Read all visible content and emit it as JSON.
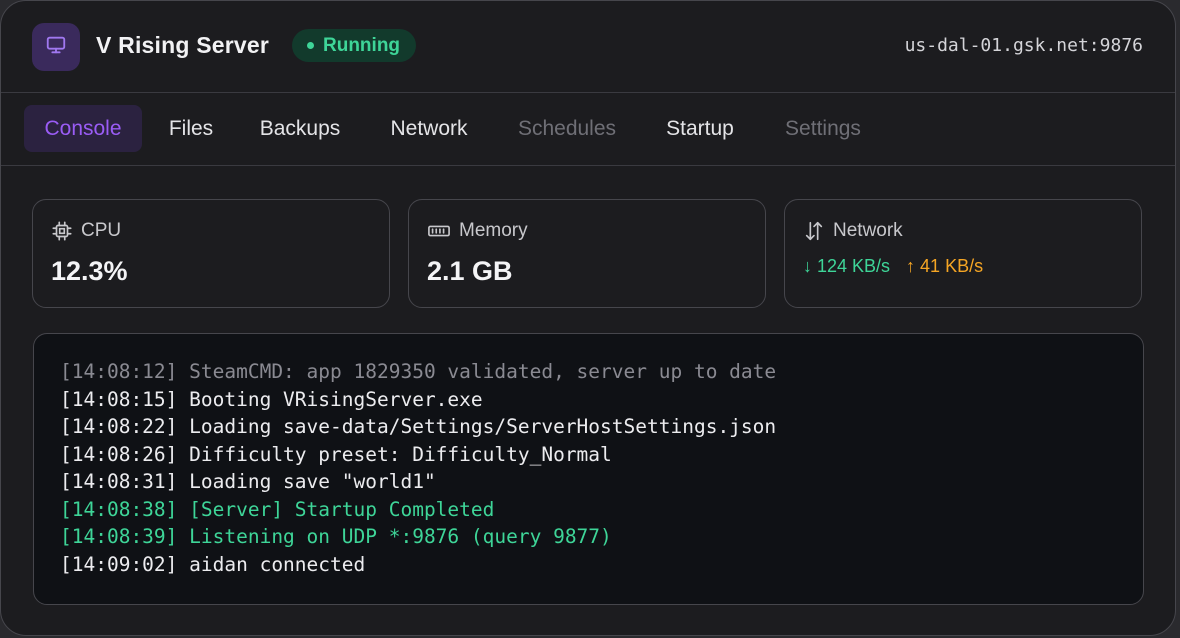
{
  "header": {
    "title": "V Rising Server",
    "status": "Running",
    "address": "us-dal-01.gsk.net:9876",
    "icon": "monitor-icon"
  },
  "tabs": [
    {
      "label": "Console",
      "state": "active"
    },
    {
      "label": "Files",
      "state": "normal"
    },
    {
      "label": "Backups",
      "state": "normal"
    },
    {
      "label": "Network",
      "state": "normal"
    },
    {
      "label": "Schedules",
      "state": "disabled"
    },
    {
      "label": "Startup",
      "state": "normal"
    },
    {
      "label": "Settings",
      "state": "disabled"
    }
  ],
  "stats": {
    "cpu": {
      "label": "CPU",
      "value": "12.3%",
      "icon": "cpu-chip-icon"
    },
    "memory": {
      "label": "Memory",
      "value": "2.1 GB",
      "icon": "memory-icon"
    },
    "network": {
      "label": "Network",
      "down": "↓ 124 KB/s",
      "up": "↑ 41 KB/s",
      "icon": "transfer-arrows-icon"
    }
  },
  "console": {
    "lines": [
      {
        "text": "[14:08:12] SteamCMD: app 1829350 validated, server up to date",
        "style": "muted"
      },
      {
        "text": "[14:08:15] Booting VRisingServer.exe",
        "style": "normal"
      },
      {
        "text": "[14:08:22] Loading save-data/Settings/ServerHostSettings.json",
        "style": "normal"
      },
      {
        "text": "[14:08:26] Difficulty preset: Difficulty_Normal",
        "style": "normal"
      },
      {
        "text": "[14:08:31] Loading save \"world1\"",
        "style": "normal"
      },
      {
        "text": "[14:08:38] [Server] Startup Completed",
        "style": "green"
      },
      {
        "text": "[14:08:39] Listening on UDP *:9876 (query 9877)",
        "style": "green"
      },
      {
        "text": "[14:09:02] aidan connected",
        "style": "normal"
      }
    ]
  },
  "colors": {
    "accent": "#9a5cf5",
    "success": "#3ed598",
    "warning": "#f5a524",
    "background": "#1c1c1f"
  }
}
